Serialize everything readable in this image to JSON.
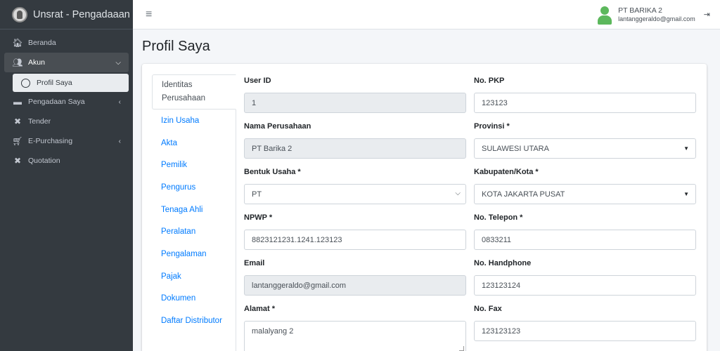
{
  "brand": {
    "title": "Unsrat - Pengadaaan Ba"
  },
  "sidebar": {
    "items": [
      {
        "label": "Beranda",
        "icon": "home-icon"
      },
      {
        "label": "Akun",
        "icon": "users-icon"
      },
      {
        "label": "Profil Saya",
        "icon": "circle-icon"
      },
      {
        "label": "Pengadaan Saya",
        "icon": "folder-icon"
      },
      {
        "label": "Tender",
        "icon": "tools-icon"
      },
      {
        "label": "E-Purchasing",
        "icon": "cart-icon"
      },
      {
        "label": "Quotation",
        "icon": "tools-icon"
      }
    ]
  },
  "header": {
    "user_name": "PT BARIKA 2",
    "user_email": "lantanggeraldo@gmail.com"
  },
  "page": {
    "title": "Profil Saya"
  },
  "tabs": [
    {
      "label": "Identitas Perusahaan"
    },
    {
      "label": "Izin Usaha"
    },
    {
      "label": "Akta"
    },
    {
      "label": "Pemilik"
    },
    {
      "label": "Pengurus"
    },
    {
      "label": "Tenaga Ahli"
    },
    {
      "label": "Peralatan"
    },
    {
      "label": "Pengalaman"
    },
    {
      "label": "Pajak"
    },
    {
      "label": "Dokumen"
    },
    {
      "label": "Daftar Distributor"
    }
  ],
  "form": {
    "user_id": {
      "label": "User ID",
      "value": "1"
    },
    "no_pkp": {
      "label": "No. PKP",
      "value": "123123"
    },
    "nama_perusahaan": {
      "label": "Nama Perusahaan",
      "value": "PT Barika 2"
    },
    "provinsi": {
      "label": "Provinsi *",
      "value": "SULAWESI UTARA"
    },
    "bentuk_usaha": {
      "label": "Bentuk Usaha *",
      "value": "PT"
    },
    "kabupaten": {
      "label": "Kabupaten/Kota *",
      "value": "KOTA JAKARTA PUSAT"
    },
    "npwp": {
      "label": "NPWP *",
      "value": "8823121231.1241.123123"
    },
    "no_telepon": {
      "label": "No. Telepon *",
      "value": "0833211"
    },
    "email": {
      "label": "Email",
      "value": "lantanggeraldo@gmail.com"
    },
    "no_handphone": {
      "label": "No. Handphone",
      "value": "123123124"
    },
    "alamat": {
      "label": "Alamat *",
      "value": "malalyang 2"
    },
    "no_fax": {
      "label": "No. Fax",
      "value": "123123123"
    }
  },
  "colors": {
    "sidebar_bg": "#343a40",
    "link": "#007bff",
    "avatar": "#5cb85c"
  }
}
